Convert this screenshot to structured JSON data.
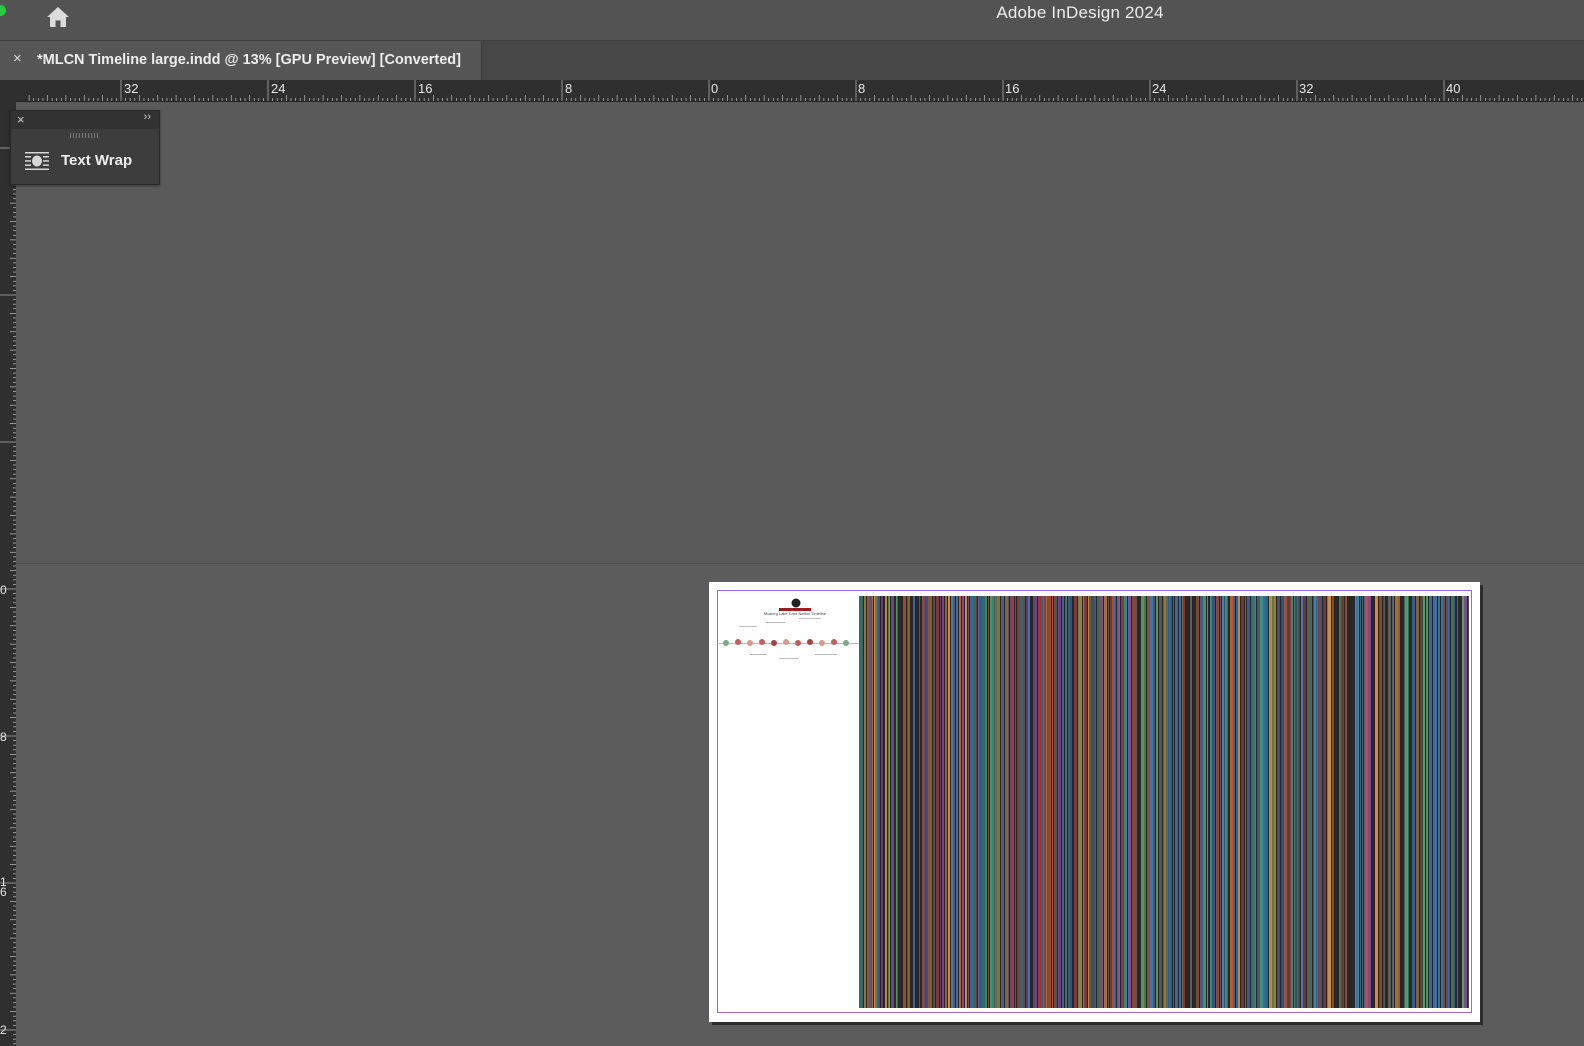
{
  "window": {
    "app_title": "Adobe InDesign 2024",
    "home_icon": "home-icon"
  },
  "tab": {
    "title": "*MLCN Timeline large.indd @ 13% [GPU Preview] [Converted]",
    "close_glyph": "×"
  },
  "ruler": {
    "horizontal_labels": [
      "32",
      "24",
      "16",
      "8",
      "0",
      "8",
      "16",
      "24",
      "32",
      "40"
    ],
    "vertical_labels": [
      "0",
      "8",
      "1\n6",
      "2"
    ]
  },
  "panel": {
    "close_glyph": "×",
    "expand_glyph": "››",
    "item_label": "Text Wrap",
    "item_icon": "text-wrap-icon"
  },
  "document": {
    "thumbnail_title": "Muskeg Lake Cree Nation Timeline",
    "colors": {
      "pasteboard": "#5c5c5c",
      "page": "#ffffff",
      "margin_guide": "#9a6bd0",
      "barcode_palette": [
        "#c0603a",
        "#3d6fb0",
        "#5a9e6a",
        "#8a4fa0",
        "#d09040",
        "#3a9a9a",
        "#b04040",
        "#606060",
        "#2a2a2a",
        "#4a7ac0"
      ]
    }
  }
}
